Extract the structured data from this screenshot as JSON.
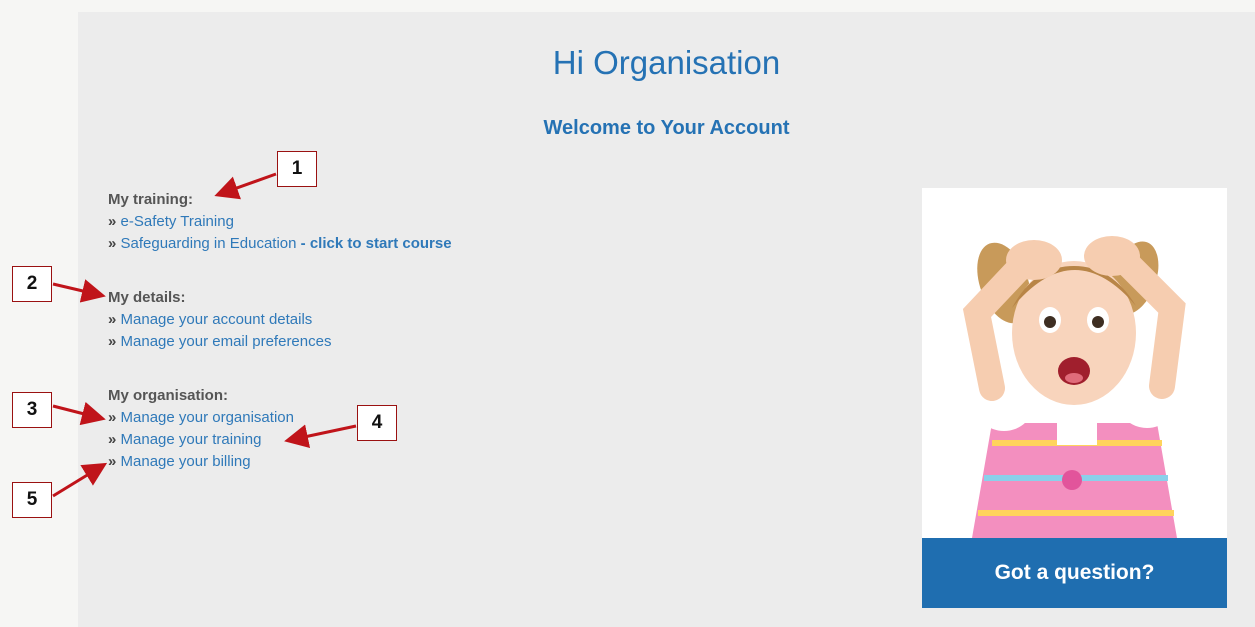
{
  "header": {
    "greeting": "Hi Organisation",
    "welcome": "Welcome to Your Account"
  },
  "training": {
    "title": "My training:",
    "items": [
      {
        "label": "e-Safety Training"
      },
      {
        "label": "Safeguarding in Education",
        "cta": "- click to start course"
      }
    ]
  },
  "details": {
    "title": "My details:",
    "items": [
      {
        "label": "Manage your account details"
      },
      {
        "label": "Manage your email preferences"
      }
    ]
  },
  "organisation": {
    "title": "My organisation:",
    "items": [
      {
        "label": "Manage your organisation"
      },
      {
        "label": "Manage your training"
      },
      {
        "label": "Manage your billing"
      }
    ]
  },
  "bullet": "»",
  "sidebar": {
    "question_label": "Got a question?"
  },
  "annotations": {
    "markers": [
      "1",
      "2",
      "3",
      "4",
      "5"
    ],
    "arrow_color": "#c0141a"
  }
}
